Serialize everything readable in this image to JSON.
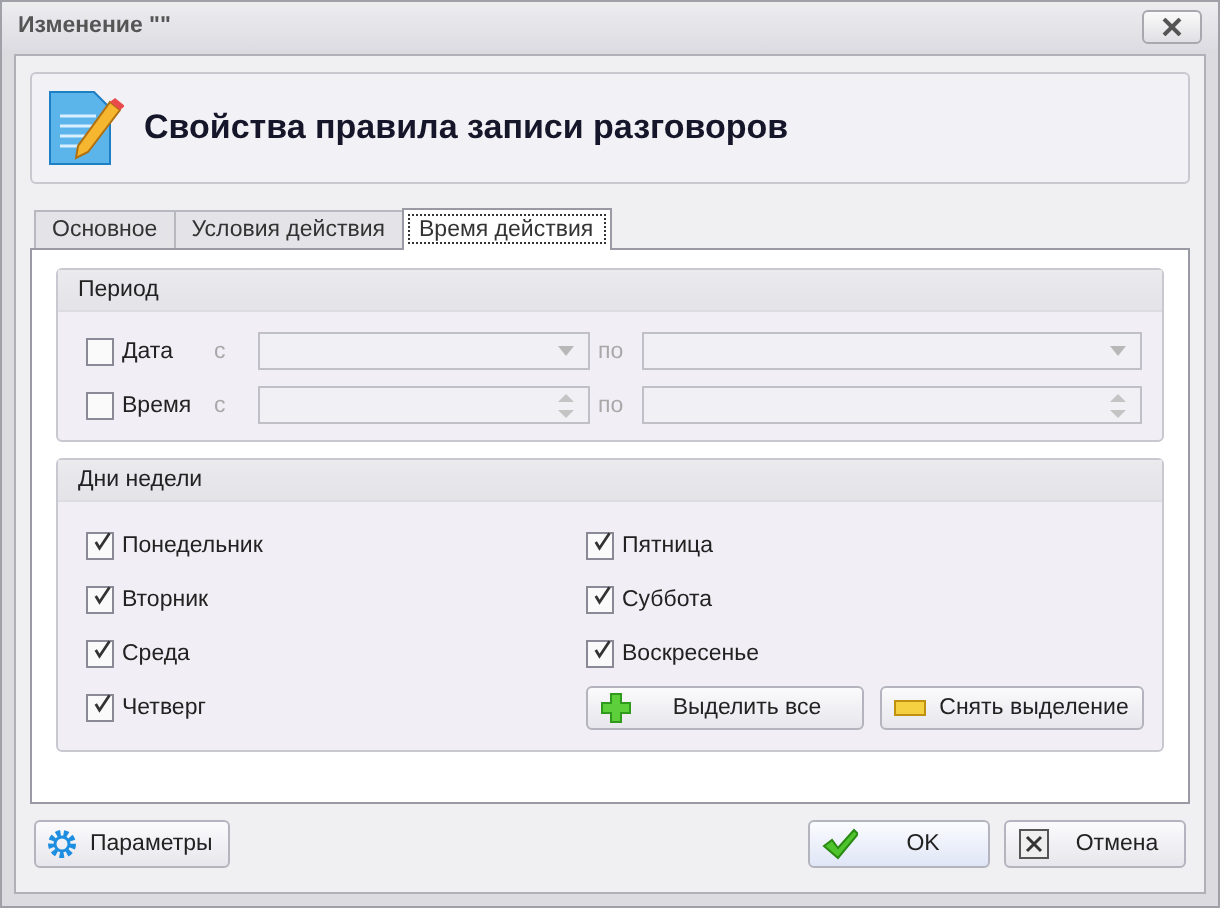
{
  "window": {
    "title": "Изменение \"\""
  },
  "header": {
    "title": "Свойства правила записи разговоров"
  },
  "tabs": [
    {
      "label": "Основное",
      "selected": false
    },
    {
      "label": "Условия действия",
      "selected": false
    },
    {
      "label": "Время действия",
      "selected": true
    }
  ],
  "period": {
    "title": "Период",
    "rows": [
      {
        "kind": "date",
        "label": "Дата",
        "checked": false,
        "from_label": "с",
        "to_label": "по",
        "disabled": true
      },
      {
        "kind": "time",
        "label": "Время",
        "checked": false,
        "from_label": "с",
        "to_label": "по",
        "disabled": true
      }
    ]
  },
  "weekdays": {
    "title": "Дни недели",
    "days": [
      {
        "label": "Понедельник",
        "checked": true
      },
      {
        "label": "Вторник",
        "checked": true
      },
      {
        "label": "Среда",
        "checked": true
      },
      {
        "label": "Четверг",
        "checked": true
      },
      {
        "label": "Пятница",
        "checked": true
      },
      {
        "label": "Суббота",
        "checked": true
      },
      {
        "label": "Воскресенье",
        "checked": true
      }
    ],
    "buttons": [
      {
        "kind": "select_all",
        "label": "Выделить все"
      },
      {
        "kind": "clear",
        "label": "Снять выделение"
      }
    ]
  },
  "footer": {
    "left": [
      {
        "kind": "settings",
        "label": "Параметры"
      }
    ],
    "right": [
      {
        "kind": "ok",
        "label": "OK"
      },
      {
        "kind": "cancel",
        "label": "Отмена"
      }
    ]
  }
}
